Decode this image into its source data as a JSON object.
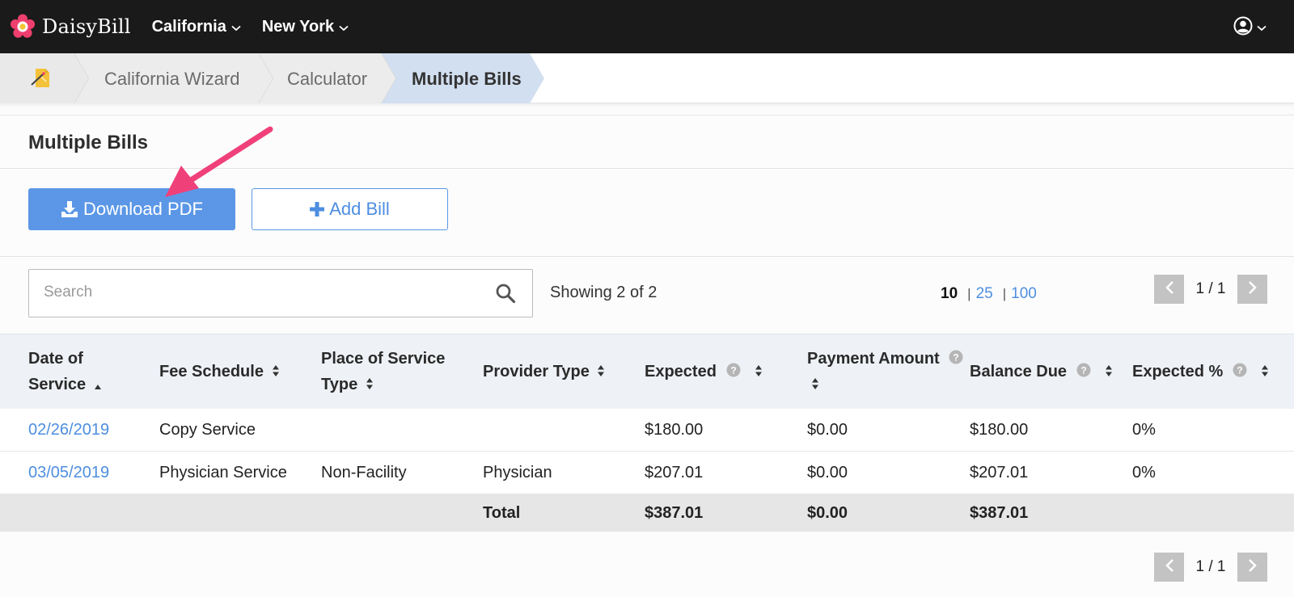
{
  "nav": {
    "logo_text": "DaisyBill",
    "items": [
      {
        "label": "California"
      },
      {
        "label": "New York"
      }
    ]
  },
  "breadcrumb": {
    "items": [
      {
        "label": "California Wizard"
      },
      {
        "label": "Calculator"
      },
      {
        "label": "Multiple Bills"
      }
    ]
  },
  "page": {
    "title": "Multiple Bills"
  },
  "actions": {
    "download_label": "Download PDF",
    "add_label": "Add Bill"
  },
  "search": {
    "placeholder": "Search",
    "value": ""
  },
  "results": {
    "showing": "Showing 2 of 2",
    "page_sizes": [
      "10",
      "25",
      "100"
    ],
    "current_page_size": "10",
    "page_label": "1 / 1"
  },
  "table": {
    "headers": {
      "date": "Date of Service",
      "fee": "Fee Schedule",
      "place": "Place of Service Type",
      "provider": "Provider Type",
      "expected": "Expected",
      "payment": "Payment Amount",
      "balance": "Balance Due",
      "pct": "Expected %"
    },
    "rows": [
      {
        "date": "02/26/2019",
        "fee": "Copy Service",
        "place": "",
        "provider": "",
        "expected": "$180.00",
        "payment": "$0.00",
        "balance": "$180.00",
        "pct": "0%"
      },
      {
        "date": "03/05/2019",
        "fee": "Physician Service",
        "place": "Non-Facility",
        "provider": "Physician",
        "expected": "$207.01",
        "payment": "$0.00",
        "balance": "$207.01",
        "pct": "0%"
      }
    ],
    "total": {
      "label": "Total",
      "expected": "$387.01",
      "payment": "$0.00",
      "balance": "$387.01"
    }
  },
  "colors": {
    "topbar": "#1a1a1a",
    "primary": "#5b97e6",
    "link": "#4e8ee0",
    "breadcrumb_active": "#d2dff0",
    "annotation_arrow": "#f0407a"
  }
}
